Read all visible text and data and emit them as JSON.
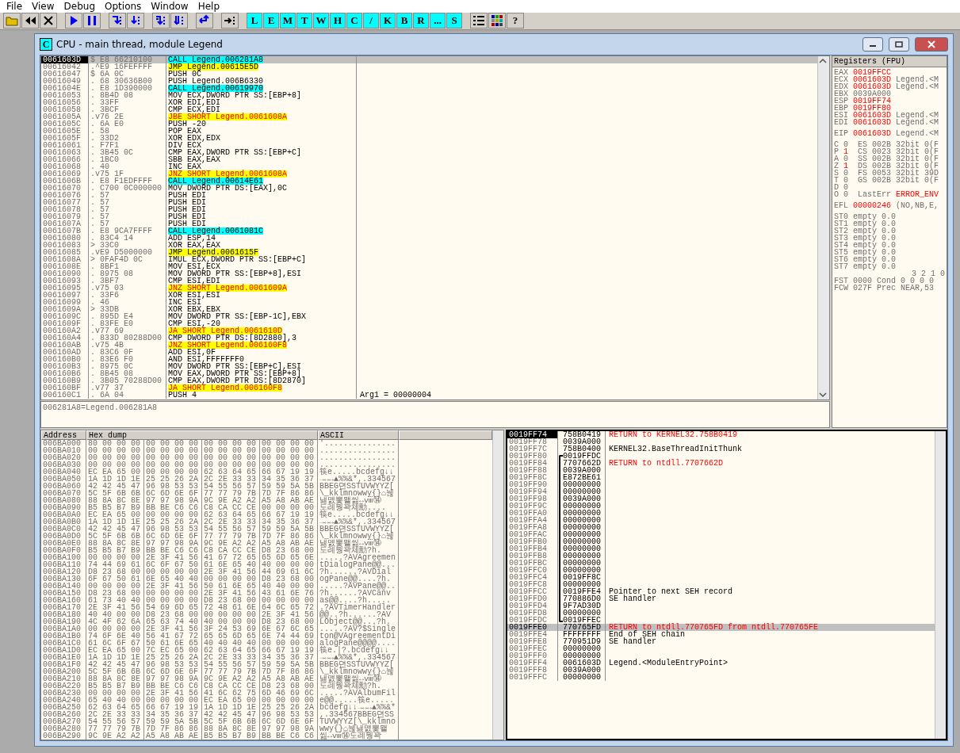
{
  "menu": [
    "File",
    "View",
    "Debug",
    "Options",
    "Window",
    "Help"
  ],
  "toolbar": {
    "letter_buttons": [
      "L",
      "E",
      "M",
      "T",
      "W",
      "H",
      "C",
      "/",
      "K",
      "B",
      "R",
      "...",
      "S"
    ],
    "help_button": "?"
  },
  "window": {
    "icon_letter": "C",
    "title": "CPU - main thread, module Legend"
  },
  "disasm": {
    "rows": [
      {
        "address": "0061603D",
        "dump": "$ E8 66210100",
        "command": "CALL Legend.006281A8",
        "kind": "call",
        "selected": true
      },
      {
        "address": "00616042",
        "dump": ".^E9 16FEFFFF",
        "command": "JMP Legend.00615E5D",
        "kind": "jmp",
        "selected": false
      },
      {
        "address": "00616047",
        "dump": "$ 6A 0C",
        "command": "PUSH 0C",
        "kind": "plain",
        "selected": false
      },
      {
        "address": "00616049",
        "dump": ". 68 30636B00",
        "command": "PUSH Legend.006B6330",
        "kind": "plain",
        "selected": false
      },
      {
        "address": "0061604E",
        "dump": ". E8 1D390000",
        "command": "CALL Legend.00619970",
        "kind": "call",
        "selected": false
      },
      {
        "address": "00616053",
        "dump": ". 8B4D 08",
        "command": "MOV ECX,DWORD PTR SS:[EBP+8]",
        "kind": "plain",
        "selected": false
      },
      {
        "address": "00616056",
        "dump": ". 33FF",
        "command": "XOR EDI,EDI",
        "kind": "plain",
        "selected": false
      },
      {
        "address": "00616058",
        "dump": ". 3BCF",
        "command": "CMP ECX,EDI",
        "kind": "plain",
        "selected": false
      },
      {
        "address": "0061605A",
        "dump": ".v76 2E",
        "command": "JBE SHORT Legend.0061608A",
        "kind": "jcc",
        "selected": false
      },
      {
        "address": "0061605C",
        "dump": ". 6A E0",
        "command": "PUSH -20",
        "kind": "plain",
        "selected": false
      },
      {
        "address": "0061605E",
        "dump": ". 58",
        "command": "POP EAX",
        "kind": "plain",
        "selected": false
      },
      {
        "address": "0061605F",
        "dump": ". 33D2",
        "command": "XOR EDX,EDX",
        "kind": "plain",
        "selected": false
      },
      {
        "address": "00616061",
        "dump": ". F7F1",
        "command": "DIV ECX",
        "kind": "plain",
        "selected": false
      },
      {
        "address": "00616063",
        "dump": ". 3B45 0C",
        "command": "CMP EAX,DWORD PTR SS:[EBP+C]",
        "kind": "plain",
        "selected": false
      },
      {
        "address": "00616066",
        "dump": ". 1BC0",
        "command": "SBB EAX,EAX",
        "kind": "plain",
        "selected": false
      },
      {
        "address": "00616068",
        "dump": ". 40",
        "command": "INC EAX",
        "kind": "plain",
        "selected": false
      },
      {
        "address": "00616069",
        "dump": ".v75 1F",
        "command": "JNZ SHORT Legend.0061608A",
        "kind": "jcc",
        "selected": false
      },
      {
        "address": "0061606B",
        "dump": ". E8 F1EDFFFF",
        "command": "CALL Legend.00614E61",
        "kind": "call",
        "selected": false
      },
      {
        "address": "00616070",
        "dump": ". C700 0C000000",
        "command": "MOV DWORD PTR DS:[EAX],0C",
        "kind": "plain",
        "selected": false
      },
      {
        "address": "00616076",
        "dump": ". 57",
        "command": "PUSH EDI",
        "kind": "plain",
        "selected": false
      },
      {
        "address": "00616077",
        "dump": ". 57",
        "command": "PUSH EDI",
        "kind": "plain",
        "selected": false
      },
      {
        "address": "00616078",
        "dump": ". 57",
        "command": "PUSH EDI",
        "kind": "plain",
        "selected": false
      },
      {
        "address": "00616079",
        "dump": ". 57",
        "command": "PUSH EDI",
        "kind": "plain",
        "selected": false
      },
      {
        "address": "0061607A",
        "dump": ". 57",
        "command": "PUSH EDI",
        "kind": "plain",
        "selected": false
      },
      {
        "address": "0061607B",
        "dump": ". E8 9CA7FFFF",
        "command": "CALL Legend.0061081C",
        "kind": "call",
        "selected": false
      },
      {
        "address": "00616080",
        "dump": ". 83C4 14",
        "command": "ADD ESP,14",
        "kind": "plain",
        "selected": false
      },
      {
        "address": "00616083",
        "dump": "> 33C0",
        "command": "XOR EAX,EAX",
        "kind": "plain",
        "selected": false
      },
      {
        "address": "00616085",
        "dump": ".vE9 D5000000",
        "command": "JMP Legend.0061615F",
        "kind": "jmp",
        "selected": false
      },
      {
        "address": "0061608A",
        "dump": "> 0FAF4D 0C",
        "command": "IMUL ECX,DWORD PTR SS:[EBP+C]",
        "kind": "plain",
        "selected": false
      },
      {
        "address": "0061608E",
        "dump": ". 8BF1",
        "command": "MOV ESI,ECX",
        "kind": "plain",
        "selected": false
      },
      {
        "address": "00616090",
        "dump": ". 8975 08",
        "command": "MOV DWORD PTR SS:[EBP+8],ESI",
        "kind": "plain",
        "selected": false
      },
      {
        "address": "00616093",
        "dump": ". 3BF7",
        "command": "CMP ESI,EDI",
        "kind": "plain",
        "selected": false
      },
      {
        "address": "00616095",
        "dump": ".v75 03",
        "command": "JNZ SHORT Legend.0061609A",
        "kind": "jcc",
        "selected": false
      },
      {
        "address": "00616097",
        "dump": ". 33F6",
        "command": "XOR ESI,ESI",
        "kind": "plain",
        "selected": false
      },
      {
        "address": "00616099",
        "dump": ". 46",
        "command": "INC ESI",
        "kind": "plain",
        "selected": false
      },
      {
        "address": "0061609A",
        "dump": "> 33DB",
        "command": "XOR EBX,EBX",
        "kind": "plain",
        "selected": false
      },
      {
        "address": "0061609C",
        "dump": ". 895D E4",
        "command": "MOV DWORD PTR SS:[EBP-1C],EBX",
        "kind": "plain",
        "selected": false
      },
      {
        "address": "0061609F",
        "dump": ". 83FE E0",
        "command": "CMP ESI,-20",
        "kind": "plain",
        "selected": false
      },
      {
        "address": "006160A2",
        "dump": ".v77 69",
        "command": "JA SHORT Legend.0061610D",
        "kind": "jcc",
        "selected": false
      },
      {
        "address": "006160A4",
        "dump": ". 833D 80288D00",
        "command": "CMP DWORD PTR DS:[8D2880],3",
        "kind": "plain",
        "selected": false
      },
      {
        "address": "006160AB",
        "dump": ".v75 4B",
        "command": "JNZ SHORT Legend.006160F8",
        "kind": "jcc",
        "selected": false
      },
      {
        "address": "006160AD",
        "dump": ". 83C6 0F",
        "command": "ADD ESI,0F",
        "kind": "plain",
        "selected": false
      },
      {
        "address": "006160B0",
        "dump": ". 83E6 F0",
        "command": "AND ESI,FFFFFFF0",
        "kind": "plain",
        "selected": false
      },
      {
        "address": "006160B3",
        "dump": ". 8975 0C",
        "command": "MOV DWORD PTR SS:[EBP+C],ESI",
        "kind": "plain",
        "selected": false
      },
      {
        "address": "006160B6",
        "dump": ". 8B45 08",
        "command": "MOV EAX,DWORD PTR SS:[EBP+8]",
        "kind": "plain",
        "selected": false
      },
      {
        "address": "006160B9",
        "dump": ". 3B05 70288D00",
        "command": "CMP EAX,DWORD PTR DS:[8D2870]",
        "kind": "plain",
        "selected": false
      },
      {
        "address": "006160BF",
        "dump": ".v77 37",
        "command": "JA SHORT Legend.006160F8",
        "kind": "jcc",
        "selected": false
      },
      {
        "address": "006160C1",
        "dump": ". 6A 04",
        "command": "PUSH 4",
        "kind": "plain",
        "selected": false,
        "comment": "Arg1 = 00000004"
      }
    ],
    "info": "006281A8=Legend.006281A8"
  },
  "registers": {
    "title": "Registers (FPU)",
    "general": [
      {
        "name": "EAX",
        "value": "0019FFCC",
        "changed": true
      },
      {
        "name": "ECX",
        "value": "0061603D",
        "changed": true,
        "comment": "Legend.<M"
      },
      {
        "name": "EDX",
        "value": "0061603D",
        "changed": true,
        "comment": "Legend.<M"
      },
      {
        "name": "EBX",
        "value": "0039A000",
        "changed": false
      },
      {
        "name": "ESP",
        "value": "0019FF74",
        "changed": true
      },
      {
        "name": "EBP",
        "value": "0019FF80",
        "changed": true
      },
      {
        "name": "ESI",
        "value": "0061603D",
        "changed": true,
        "comment": "Legend.<M"
      },
      {
        "name": "EDI",
        "value": "0061603D",
        "changed": true,
        "comment": "Legend.<M"
      }
    ],
    "eip": {
      "name": "EIP",
      "value": "0061603D",
      "changed": true,
      "comment": "Legend.<M"
    },
    "flags": [
      {
        "name": "C",
        "value": "0",
        "changed": false,
        "segment": "ES 002B 32bit 0(F"
      },
      {
        "name": "P",
        "value": "1",
        "changed": true,
        "segment": "CS 0023 32bit 0(F"
      },
      {
        "name": "A",
        "value": "0",
        "changed": false,
        "segment": "SS 002B 32bit 0(F"
      },
      {
        "name": "Z",
        "value": "1",
        "changed": true,
        "segment": "DS 002B 32bit 0(F"
      },
      {
        "name": "S",
        "value": "0",
        "changed": false,
        "segment": "FS 0053 32bit 39D"
      },
      {
        "name": "T",
        "value": "0",
        "changed": false,
        "segment": "GS 002B 32bit 0(F"
      },
      {
        "name": "D",
        "value": "0",
        "changed": false
      },
      {
        "name": "O",
        "value": "0",
        "changed": false,
        "last_error": {
          "label": "LastErr",
          "value": "ERROR_ENV",
          "changed": true
        }
      }
    ],
    "efl": {
      "name": "EFL",
      "value": "00000246",
      "changed": true,
      "comment": "(NO,NB,E,"
    },
    "fpu": [
      {
        "name": "ST0",
        "tag": "empty",
        "value": "0.0"
      },
      {
        "name": "ST1",
        "tag": "empty",
        "value": "0.0"
      },
      {
        "name": "ST2",
        "tag": "empty",
        "value": "0.0"
      },
      {
        "name": "ST3",
        "tag": "empty",
        "value": "0.0"
      },
      {
        "name": "ST4",
        "tag": "empty",
        "value": "0.0"
      },
      {
        "name": "ST5",
        "tag": "empty",
        "value": "0.0"
      },
      {
        "name": "ST6",
        "tag": "empty",
        "value": "0.0"
      },
      {
        "name": "ST7",
        "tag": "empty",
        "value": "0.0"
      }
    ],
    "cond_header": "3 2 1 0",
    "fst": {
      "name": "FST",
      "value": "0000",
      "label": "Cond",
      "info": "0 0 0 0"
    },
    "fcw": {
      "name": "FCW",
      "value": "027F",
      "label": "Prec",
      "info": "NEAR,53"
    }
  },
  "dump": {
    "columns": [
      "Address",
      "Hex dump",
      "ASCII"
    ],
    "rows": [
      {
        "address": "006BA000",
        "hex": [
          "80 00 00 00",
          "00 00 00 00",
          "00 00 00 00",
          "00 00 00 00"
        ],
        "ascii": "'..............."
      },
      {
        "address": "006BA010",
        "hex": [
          "00 00 00 00",
          "00 00 00 00",
          "00 00 00 00",
          "00 00 00 00"
        ],
        "ascii": "................"
      },
      {
        "address": "006BA020",
        "hex": [
          "00 00 00 00",
          "00 00 00 00",
          "00 00 00 00",
          "00 00 00 00"
        ],
        "ascii": "................"
      },
      {
        "address": "006BA030",
        "hex": [
          "00 00 00 00",
          "00 00 00 00",
          "00 00 00 00",
          "00 00 00 00"
        ],
        "ascii": "................"
      },
      {
        "address": "006BA040",
        "hex": [
          "EC EA 65 00",
          "00 00 00 00",
          "62 63 64 65",
          "66 67 19 19"
        ],
        "ascii": "筷e.....bcdefg↓↓"
      },
      {
        "address": "006BA050",
        "hex": [
          "1A 1D 1D 1E",
          "25 25 26 2A",
          "2C 2E 33 33",
          "34 35 36 37"
        ],
        "ascii": "→↔↔▲%%&*,.334567"
      },
      {
        "address": "006BA060",
        "hex": [
          "42 42 45 47",
          "96 98 53 53",
          "54 55 56 57",
          "59 59 5A 5B"
        ],
        "ascii": "BBEG뎐SSTUVWYYZ["
      },
      {
        "address": "006BA070",
        "hex": [
          "5C 5F 6B 6B",
          "6C 6D 6E 6F",
          "77 77 79 7B",
          "7D 7F 86 86"
        ],
        "ascii": "\\_kklmnowwy{}⌂뉂"
      },
      {
        "address": "006BA080",
        "hex": [
          "88 8A 8C 8E",
          "97 97 98 9A",
          "9C 9E A2 A2",
          "A5 A8 AB AE"
        ],
        "ascii": "냃먨뽗뫨씶↔ⅷ⑭"
      },
      {
        "address": "006BA090",
        "hex": [
          "B5 B5 B7 B9",
          "BB BE C6 C6",
          "C8 CA CC CE",
          "00 00 00 00"
        ],
        "ascii": "도례뭥꽉쳬勳...."
      },
      {
        "address": "006BA0A0",
        "hex": [
          "EC EA 65 00",
          "00 00 00 00",
          "62 63 64 65",
          "66 67 19 19"
        ],
        "ascii": "筷e.....bcdefg↓↓"
      },
      {
        "address": "006BA0B0",
        "hex": [
          "1A 1D 1D 1E",
          "25 25 26 2A",
          "2C 2E 33 33",
          "34 35 36 37"
        ],
        "ascii": "→↔↔▲%%&*,.334567"
      },
      {
        "address": "006BA0C0",
        "hex": [
          "42 42 45 47",
          "96 98 53 53",
          "54 55 56 57",
          "59 59 5A 5B"
        ],
        "ascii": "BBEG뎐SSTUVWYYZ["
      },
      {
        "address": "006BA0D0",
        "hex": [
          "5C 5F 6B 6B",
          "6C 6D 6E 6F",
          "77 77 79 7B",
          "7D 7F 86 86"
        ],
        "ascii": "\\_kklmnowwy{}⌂뉂"
      },
      {
        "address": "006BA0E0",
        "hex": [
          "88 8A 8C 8E",
          "97 97 98 9A",
          "9C 9E A2 A2",
          "A5 A8 AB AE"
        ],
        "ascii": "냃먨뽗뫨씶↔ⅷ⑭"
      },
      {
        "address": "006BA0F0",
        "hex": [
          "B5 B5 B7 B9",
          "BB BE C6 C6",
          "C8 CA CC CE",
          "D8 23 68 00"
        ],
        "ascii": "도례뭥꽉쳬勳?h."
      },
      {
        "address": "006BA100",
        "hex": [
          "00 00 00 00",
          "2E 3F 41 56",
          "41 67 72 65",
          "65 6D 65 6E"
        ],
        "ascii": ".....?AVAgreemen"
      },
      {
        "address": "006BA110",
        "hex": [
          "74 44 69 61",
          "6C 6F 67 50",
          "61 6E 65 40",
          "40 00 00 00"
        ],
        "ascii": "tDialogPane@@..."
      },
      {
        "address": "006BA120",
        "hex": [
          "D8 23 68 00",
          "00 00 00 00",
          "2E 3F 41 56",
          "44 69 61 6C"
        ],
        "ascii": "?h......?AVDial"
      },
      {
        "address": "006BA130",
        "hex": [
          "6F 67 50 61",
          "6E 65 40 40",
          "00 00 00 00",
          "D8 23 68 00"
        ],
        "ascii": "ogPane@@....?h."
      },
      {
        "address": "006BA140",
        "hex": [
          "00 00 00 00",
          "2E 3F 41 56",
          "50 61 6E 65",
          "40 40 00 00"
        ],
        "ascii": ".....?AVPane@@.."
      },
      {
        "address": "006BA150",
        "hex": [
          "D8 23 68 00",
          "00 00 00 00",
          "2E 3F 41 56",
          "43 61 6E 76"
        ],
        "ascii": "?h......?AVCanv"
      },
      {
        "address": "006BA160",
        "hex": [
          "61 73 40 40",
          "00 00 00 00",
          "D8 23 68 00",
          "00 00 00 00"
        ],
        "ascii": "as@@....?h....."
      },
      {
        "address": "006BA170",
        "hex": [
          "2E 3F 41 56",
          "54 69 6D 65",
          "72 48 61 6E",
          "64 6C 65 72"
        ],
        "ascii": ".?AVTimerHandler"
      },
      {
        "address": "006BA180",
        "hex": [
          "40 40 00 00",
          "D8 23 68 00",
          "00 00 00 00",
          "2E 3F 41 56"
        ],
        "ascii": "@@..?h......?AV"
      },
      {
        "address": "006BA190",
        "hex": [
          "4C 4F 62 6A",
          "65 63 74 40",
          "40 00 00 00",
          "D8 23 68 00"
        ],
        "ascii": "LObject@@...?h."
      },
      {
        "address": "006BA1A0",
        "hex": [
          "00 00 00 00",
          "2E 3F 41 56",
          "3F 24 53 69",
          "6E 67 6C 65"
        ],
        "ascii": ".....?AV?$Single"
      },
      {
        "address": "006BA1B0",
        "hex": [
          "74 6F 6E 40",
          "56 41 67 72",
          "65 65 6D 65",
          "6E 74 44 69"
        ],
        "ascii": "ton@VAgreementDi"
      },
      {
        "address": "006BA1C0",
        "hex": [
          "61 6C 6F 67",
          "50 61 6E 65",
          "40 40 40 40",
          "00 00 00 00"
        ],
        "ascii": "alogPane@@@@...."
      },
      {
        "address": "006BA1D0",
        "hex": [
          "EC EA 65 00",
          "7C EC 65 00",
          "62 63 64 65",
          "66 67 19 19"
        ],
        "ascii": "筷e.|?.bcdefg↓↓"
      },
      {
        "address": "006BA1E0",
        "hex": [
          "1A 1D 1D 1E",
          "25 25 26 2A",
          "2C 2E 33 33",
          "34 35 36 37"
        ],
        "ascii": "→↔↔▲%%&*,.334567"
      },
      {
        "address": "006BA1F0",
        "hex": [
          "42 42 45 47",
          "96 98 53 53",
          "54 55 56 57",
          "59 59 5A 5B"
        ],
        "ascii": "BBEG뎐SSTUVWYYZ["
      },
      {
        "address": "006BA200",
        "hex": [
          "5C 5F 6B 6B",
          "6C 6D 6E 6F",
          "77 77 79 7B",
          "7D 7F 86 86"
        ],
        "ascii": "\\_kklmnowwy{}⌂뉂"
      },
      {
        "address": "006BA210",
        "hex": [
          "88 8A 8C 8E",
          "97 97 98 9A",
          "9C 9E A2 A2",
          "A5 A8 AB AE"
        ],
        "ascii": "냃먨뽗뫨씶↔ⅷ⑭"
      },
      {
        "address": "006BA220",
        "hex": [
          "B5 B5 B7 B9",
          "BB BE C6 C6",
          "C8 CA CC CE",
          "D8 23 68 00"
        ],
        "ascii": "도례뭥꽉쳬勳?h."
      },
      {
        "address": "006BA230",
        "hex": [
          "00 00 00 00",
          "2E 3F 41 56",
          "41 6C 62 75",
          "6D 46 69 6C"
        ],
        "ascii": ".....?AVAlbumFil"
      },
      {
        "address": "006BA240",
        "hex": [
          "65 40 40 00",
          "00 00 00 00",
          "EC EA 65 00",
          "00 00 00 00"
        ],
        "ascii": "e@@.....筷e....."
      },
      {
        "address": "006BA250",
        "hex": [
          "62 63 64 65",
          "66 67 19 19",
          "1A 1D 1D 1E",
          "25 25 26 2A"
        ],
        "ascii": "bcdefg↓↓→↔↔▲%%&*"
      },
      {
        "address": "006BA260",
        "hex": [
          "2C 2E 33 33",
          "34 35 36 37",
          "42 42 45 47",
          "96 98 53 53"
        ],
        "ascii": ",.334567BBEG뎐SS"
      },
      {
        "address": "006BA270",
        "hex": [
          "54 55 56 57",
          "59 59 5A 5B",
          "5C 5F 6B 6B",
          "6C 6D 6E 6F"
        ],
        "ascii": "TUVWYYZ[\\_kklmno"
      },
      {
        "address": "006BA280",
        "hex": [
          "77 77 79 7B",
          "7D 7F 86 86",
          "88 8A 8C 8E",
          "97 97 98 9A"
        ],
        "ascii": "wwy{}⌂뉂냃먨뽗뫨"
      },
      {
        "address": "006BA290",
        "hex": [
          "9C 9E A2 A2",
          "A5 A8 AB AE",
          "B5 B5 B7 B9",
          "BB BE C6 C6"
        ],
        "ascii": "씶↔ⅷ⑭도례뭥꽉"
      }
    ]
  },
  "stack": {
    "rows": [
      {
        "address": "0019FF74",
        "value": "758B0419",
        "comment": "RETURN to KERNEL32.758B0419",
        "kind": "return",
        "top": true,
        "selected": false
      },
      {
        "address": "0019FF78",
        "value": "0039A000",
        "selected": false
      },
      {
        "address": "0019FF7C",
        "value": "758B0400",
        "comment": "KERNEL32.BaseThreadInitThunk",
        "kind": "plain",
        "selected": false
      },
      {
        "address": "0019FF80",
        "value": "0019FFDC",
        "selected": false,
        "frame_start": true
      },
      {
        "address": "0019FF84",
        "value": "7707662D",
        "comment": "RETURN to ntdll.7707662D",
        "kind": "return",
        "selected": false
      },
      {
        "address": "0019FF88",
        "value": "0039A000",
        "selected": false
      },
      {
        "address": "0019FF8C",
        "value": "E872BE61",
        "selected": false
      },
      {
        "address": "0019FF90",
        "value": "00000000",
        "selected": false
      },
      {
        "address": "0019FF94",
        "value": "00000000",
        "selected": false
      },
      {
        "address": "0019FF98",
        "value": "0039A000",
        "selected": false
      },
      {
        "address": "0019FF9C",
        "value": "00000000",
        "selected": false
      },
      {
        "address": "0019FFA0",
        "value": "00000000",
        "selected": false
      },
      {
        "address": "0019FFA4",
        "value": "00000000",
        "selected": false
      },
      {
        "address": "0019FFA8",
        "value": "00000000",
        "selected": false
      },
      {
        "address": "0019FFAC",
        "value": "00000000",
        "selected": false
      },
      {
        "address": "0019FFB0",
        "value": "00000000",
        "selected": false
      },
      {
        "address": "0019FFB4",
        "value": "00000000",
        "selected": false
      },
      {
        "address": "0019FFB8",
        "value": "00000000",
        "selected": false
      },
      {
        "address": "0019FFBC",
        "value": "00000000",
        "selected": false
      },
      {
        "address": "0019FFC0",
        "value": "00000000",
        "selected": false
      },
      {
        "address": "0019FFC4",
        "value": "0019FF8C",
        "selected": false
      },
      {
        "address": "0019FFC8",
        "value": "00000000",
        "selected": false
      },
      {
        "address": "0019FFCC",
        "value": "0019FFE4",
        "comment": "Pointer to next SEH record",
        "kind": "plain",
        "selected": false
      },
      {
        "address": "0019FFD0",
        "value": "770886D0",
        "comment": "SE handler",
        "kind": "plain",
        "selected": false
      },
      {
        "address": "0019FFD4",
        "value": "9F7AD30D",
        "selected": false
      },
      {
        "address": "0019FFD8",
        "value": "00000000",
        "selected": false
      },
      {
        "address": "0019FFDC",
        "value": "0019FFEC",
        "selected": false,
        "frame_end": true
      },
      {
        "address": "0019FFE0",
        "value": "770765FD",
        "comment": "RETURN to ntdll.770765FD from ntdll.770765FE",
        "kind": "return",
        "selected": true
      },
      {
        "address": "0019FFE4",
        "value": "FFFFFFFF",
        "comment": "End of SEH chain",
        "kind": "plain",
        "selected": false
      },
      {
        "address": "0019FFE8",
        "value": "770951D9",
        "comment": "SE handler",
        "kind": "plain",
        "selected": false
      },
      {
        "address": "0019FFEC",
        "value": "00000000",
        "selected": false
      },
      {
        "address": "0019FFF0",
        "value": "00000000",
        "selected": false
      },
      {
        "address": "0019FFF4",
        "value": "0061603D",
        "comment": "Legend.<ModuleEntryPoint>",
        "kind": "plain",
        "selected": false
      },
      {
        "address": "0019FFF8",
        "value": "0039A000",
        "selected": false
      },
      {
        "address": "0019FFFC",
        "value": "00000000",
        "selected": false
      }
    ]
  }
}
